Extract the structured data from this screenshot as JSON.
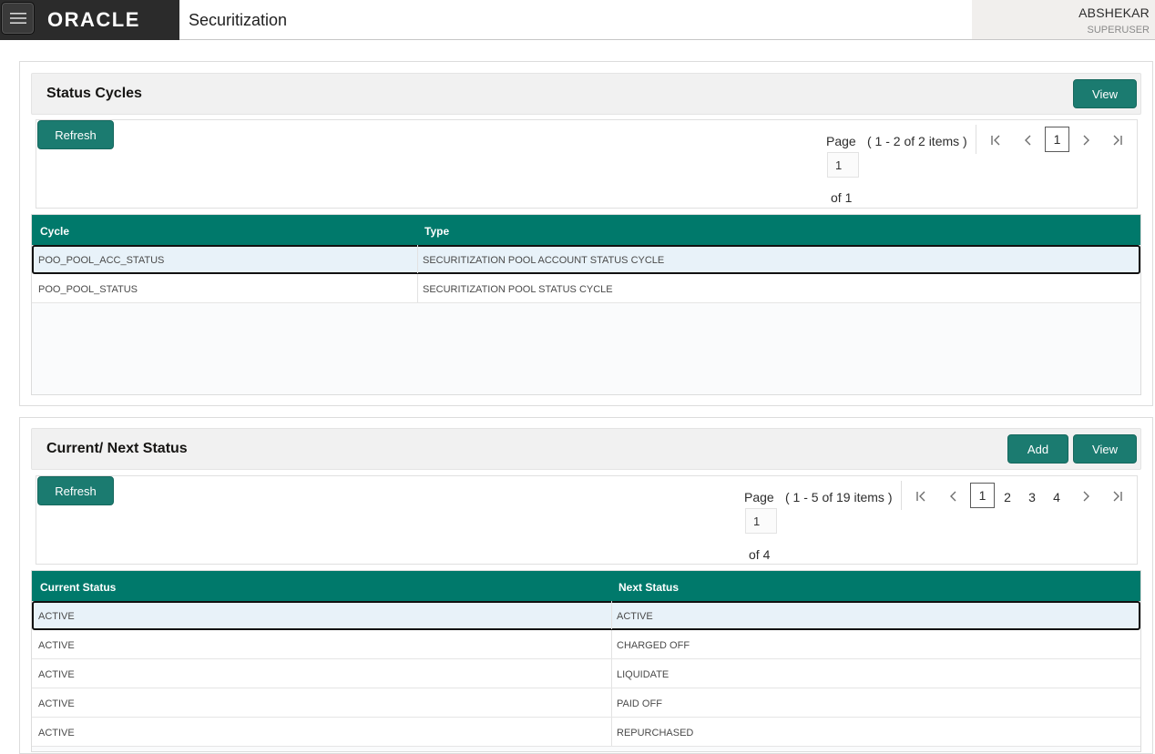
{
  "header": {
    "menu_icon": "hamburger-menu-icon",
    "logo_text": "ORACLE",
    "app_title": "Securitization",
    "user_name": "ABSHEKAR",
    "user_role": "SUPERUSER"
  },
  "status_cycles": {
    "title": "Status Cycles",
    "view_label": "View",
    "refresh_label": "Refresh",
    "pager": {
      "page_label": "Page",
      "count_text": "( 1 - 2 of 2 items )",
      "current_page": "1",
      "of_text": "of 1",
      "pages": [
        "1"
      ]
    },
    "columns": [
      "Cycle",
      "Type"
    ],
    "rows": [
      {
        "cycle": "POO_POOL_ACC_STATUS",
        "type": "SECURITIZATION POOL ACCOUNT STATUS CYCLE"
      },
      {
        "cycle": "POO_POOL_STATUS",
        "type": "SECURITIZATION POOL STATUS CYCLE"
      }
    ]
  },
  "next_status": {
    "title": "Current/ Next Status",
    "add_label": "Add",
    "view_label": "View",
    "refresh_label": "Refresh",
    "pager": {
      "page_label": "Page",
      "count_text": "( 1 - 5 of 19 items )",
      "current_page": "1",
      "of_text": "of 4",
      "pages": [
        "1",
        "2",
        "3",
        "4"
      ]
    },
    "columns": [
      "Current Status",
      "Next Status"
    ],
    "rows": [
      {
        "current": "ACTIVE",
        "next": "ACTIVE"
      },
      {
        "current": "ACTIVE",
        "next": "CHARGED OFF"
      },
      {
        "current": "ACTIVE",
        "next": "LIQUIDATE"
      },
      {
        "current": "ACTIVE",
        "next": "PAID OFF"
      },
      {
        "current": "ACTIVE",
        "next": "REPURCHASED"
      }
    ]
  },
  "colors": {
    "accent": "#1b7b70",
    "grid_header": "#00796b",
    "header_dark": "#2b2b2b"
  }
}
